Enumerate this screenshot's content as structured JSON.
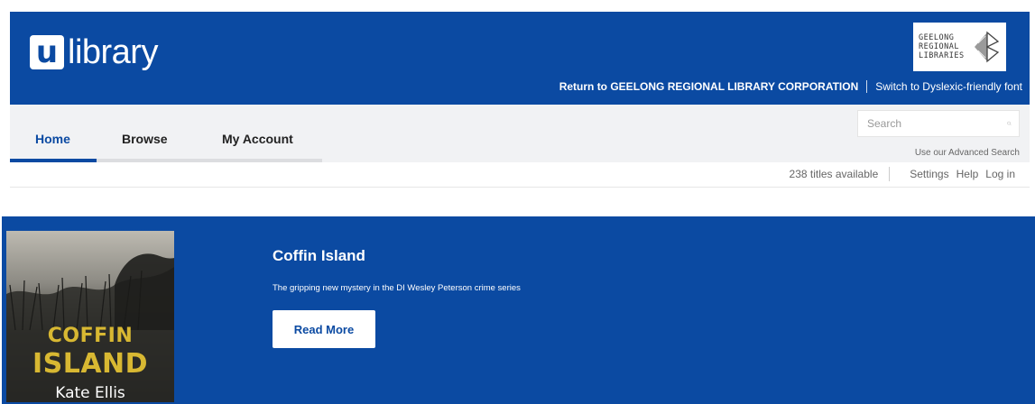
{
  "brand": {
    "logo_mark": "u",
    "logo_text": "library",
    "partner_lines": [
      "GEELONG",
      "REGIONAL",
      "LIBRARIES"
    ]
  },
  "header_links": {
    "return_link": "Return to GEELONG REGIONAL LIBRARY CORPORATION",
    "dyslexic_link": "Switch to Dyslexic-friendly font"
  },
  "nav": {
    "tabs": [
      {
        "label": "Home",
        "active": true
      },
      {
        "label": "Browse",
        "active": false
      },
      {
        "label": "My Account",
        "active": false
      }
    ]
  },
  "search": {
    "placeholder": "Search",
    "advanced_link": "Use our Advanced Search"
  },
  "status": {
    "titles_available": "238 titles available",
    "settings": "Settings",
    "help": "Help",
    "login": "Log in"
  },
  "feature": {
    "title": "Coffin Island",
    "description": "The gripping new mystery in the DI Wesley Peterson crime series",
    "button_label": "Read More",
    "cover": {
      "title_line1": "COFFIN",
      "title_line2": "ISLAND",
      "author": "Kate Ellis"
    }
  },
  "colors": {
    "brand_blue": "#0b4aa2",
    "cover_title_gold": "#d8b832"
  }
}
